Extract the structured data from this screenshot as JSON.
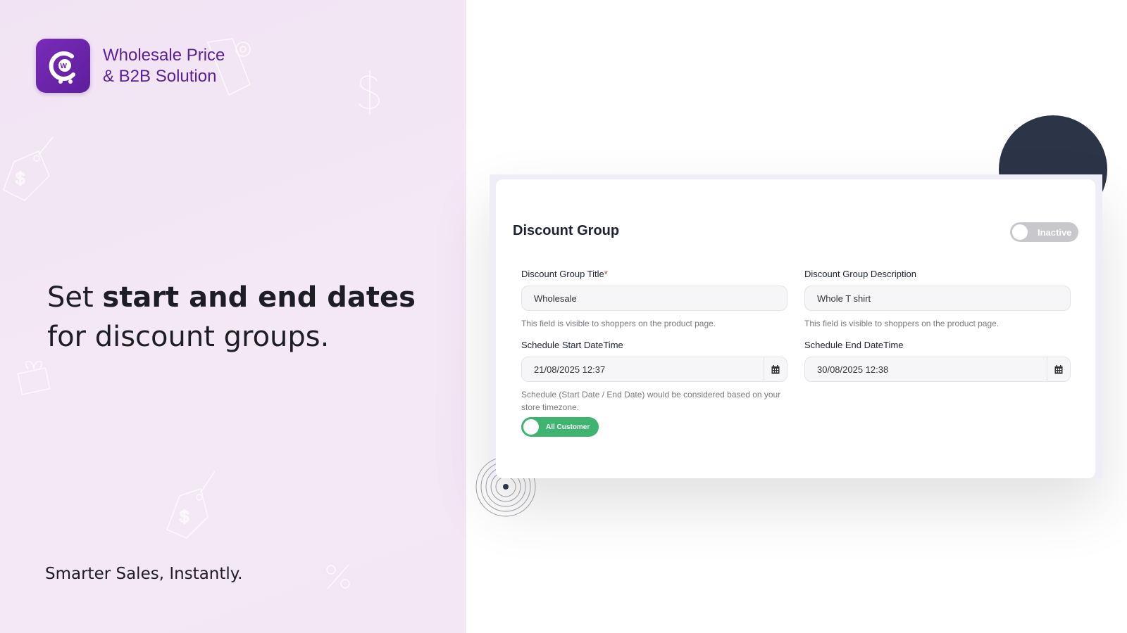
{
  "brand": {
    "name_line1": "Wholesale Price",
    "name_line2": "& B2B Solution"
  },
  "promo": {
    "headline_pre": "Set ",
    "headline_bold": "start and end dates",
    "headline_post": " for discount groups.",
    "tagline": "Smarter Sales, Instantly."
  },
  "card": {
    "title": "Discount Group",
    "status_label": "Inactive",
    "title_field": {
      "label": "Discount Group Title",
      "required_mark": "*",
      "value": "Wholesale",
      "help": "This field is visible to shoppers on the product page."
    },
    "description_field": {
      "label": "Discount Group Description",
      "value": "Whole T shirt",
      "help": "This field is visible to shoppers on the product page."
    },
    "start_field": {
      "label": "Schedule Start DateTime",
      "value": "21/08/2025 12:37",
      "help": "Schedule (Start Date / End Date) would be considered based on your store timezone."
    },
    "end_field": {
      "label": "Schedule End DateTime",
      "value": "30/08/2025 12:38"
    },
    "audience_toggle_label": "All Customer"
  },
  "colors": {
    "brand_purple": "#5b1f9a",
    "toggle_active": "#3fb46e",
    "toggle_inactive": "#c8c8cc"
  }
}
